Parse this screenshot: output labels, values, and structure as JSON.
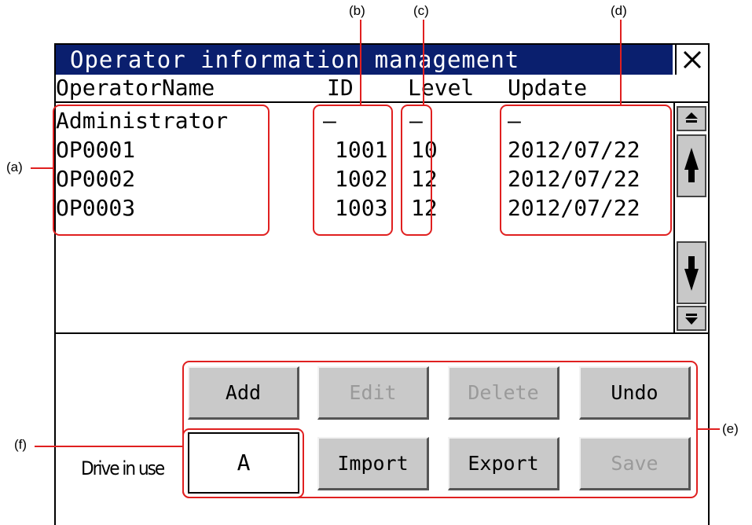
{
  "window": {
    "title": "Operator information management",
    "close_label": "✕"
  },
  "columns": {
    "name": "OperatorName",
    "id": "ID",
    "level": "Level",
    "update": "Update"
  },
  "operators": [
    {
      "name": "Administrator",
      "id": "—",
      "level": "—",
      "update": "—"
    },
    {
      "name": "OP0001",
      "id": "1001",
      "level": "10",
      "update": "2012/07/22"
    },
    {
      "name": "OP0002",
      "id": "1002",
      "level": "12",
      "update": "2012/07/22"
    },
    {
      "name": "OP0003",
      "id": "1003",
      "level": "12",
      "update": "2012/07/22"
    }
  ],
  "scrollbar": {
    "icons": [
      "scroll-top-icon",
      "scroll-up-icon",
      "scroll-down-icon",
      "scroll-bottom-icon"
    ]
  },
  "buttons": {
    "add": "Add",
    "edit": "Edit",
    "delete": "Delete",
    "undo": "Undo",
    "import": "Import",
    "export": "Export",
    "save": "Save"
  },
  "drive": {
    "label": "Drive in use",
    "value": "A"
  },
  "callouts": {
    "a": "(a)",
    "b": "(b)",
    "c": "(c)",
    "d": "(d)",
    "e": "(e)",
    "f": "(f)"
  },
  "colors": {
    "titlebar": "#0a1f6e",
    "callout": "#e02020",
    "button": "#c9c9c9",
    "disabled_text": "#9a9a9a"
  }
}
